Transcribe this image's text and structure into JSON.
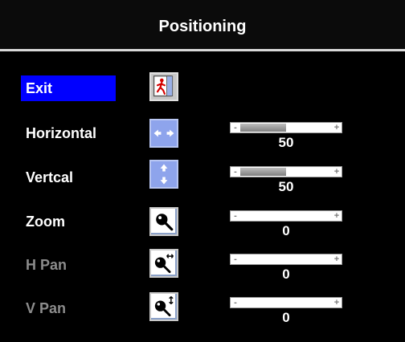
{
  "title": "Positioning",
  "items": [
    {
      "label": "Exit",
      "state": "selected",
      "icon": "exit-door-icon"
    },
    {
      "label": "Horizontal",
      "state": "enabled",
      "icon": "horizontal-arrows-icon",
      "slider": {
        "value": "50",
        "fill_fraction": 0.5
      }
    },
    {
      "label": "Vertcal",
      "state": "enabled",
      "icon": "vertical-arrows-icon",
      "slider": {
        "value": "50",
        "fill_fraction": 0.5
      }
    },
    {
      "label": "Zoom",
      "state": "enabled",
      "icon": "magnifier-icon",
      "slider": {
        "value": "0",
        "fill_fraction": 0
      }
    },
    {
      "label": "H Pan",
      "state": "disabled",
      "icon": "horizontal-pan-icon",
      "slider": {
        "value": "0",
        "fill_fraction": 0
      }
    },
    {
      "label": "V Pan",
      "state": "disabled",
      "icon": "vertical-pan-icon",
      "slider": {
        "value": "0",
        "fill_fraction": 0
      }
    }
  ],
  "slider_symbols": {
    "minus": "-",
    "plus": "+"
  },
  "colors": {
    "selected_bg": "#0000ff",
    "disabled_text": "#8c8c8c",
    "slider_fill": "#9a9a9a"
  }
}
